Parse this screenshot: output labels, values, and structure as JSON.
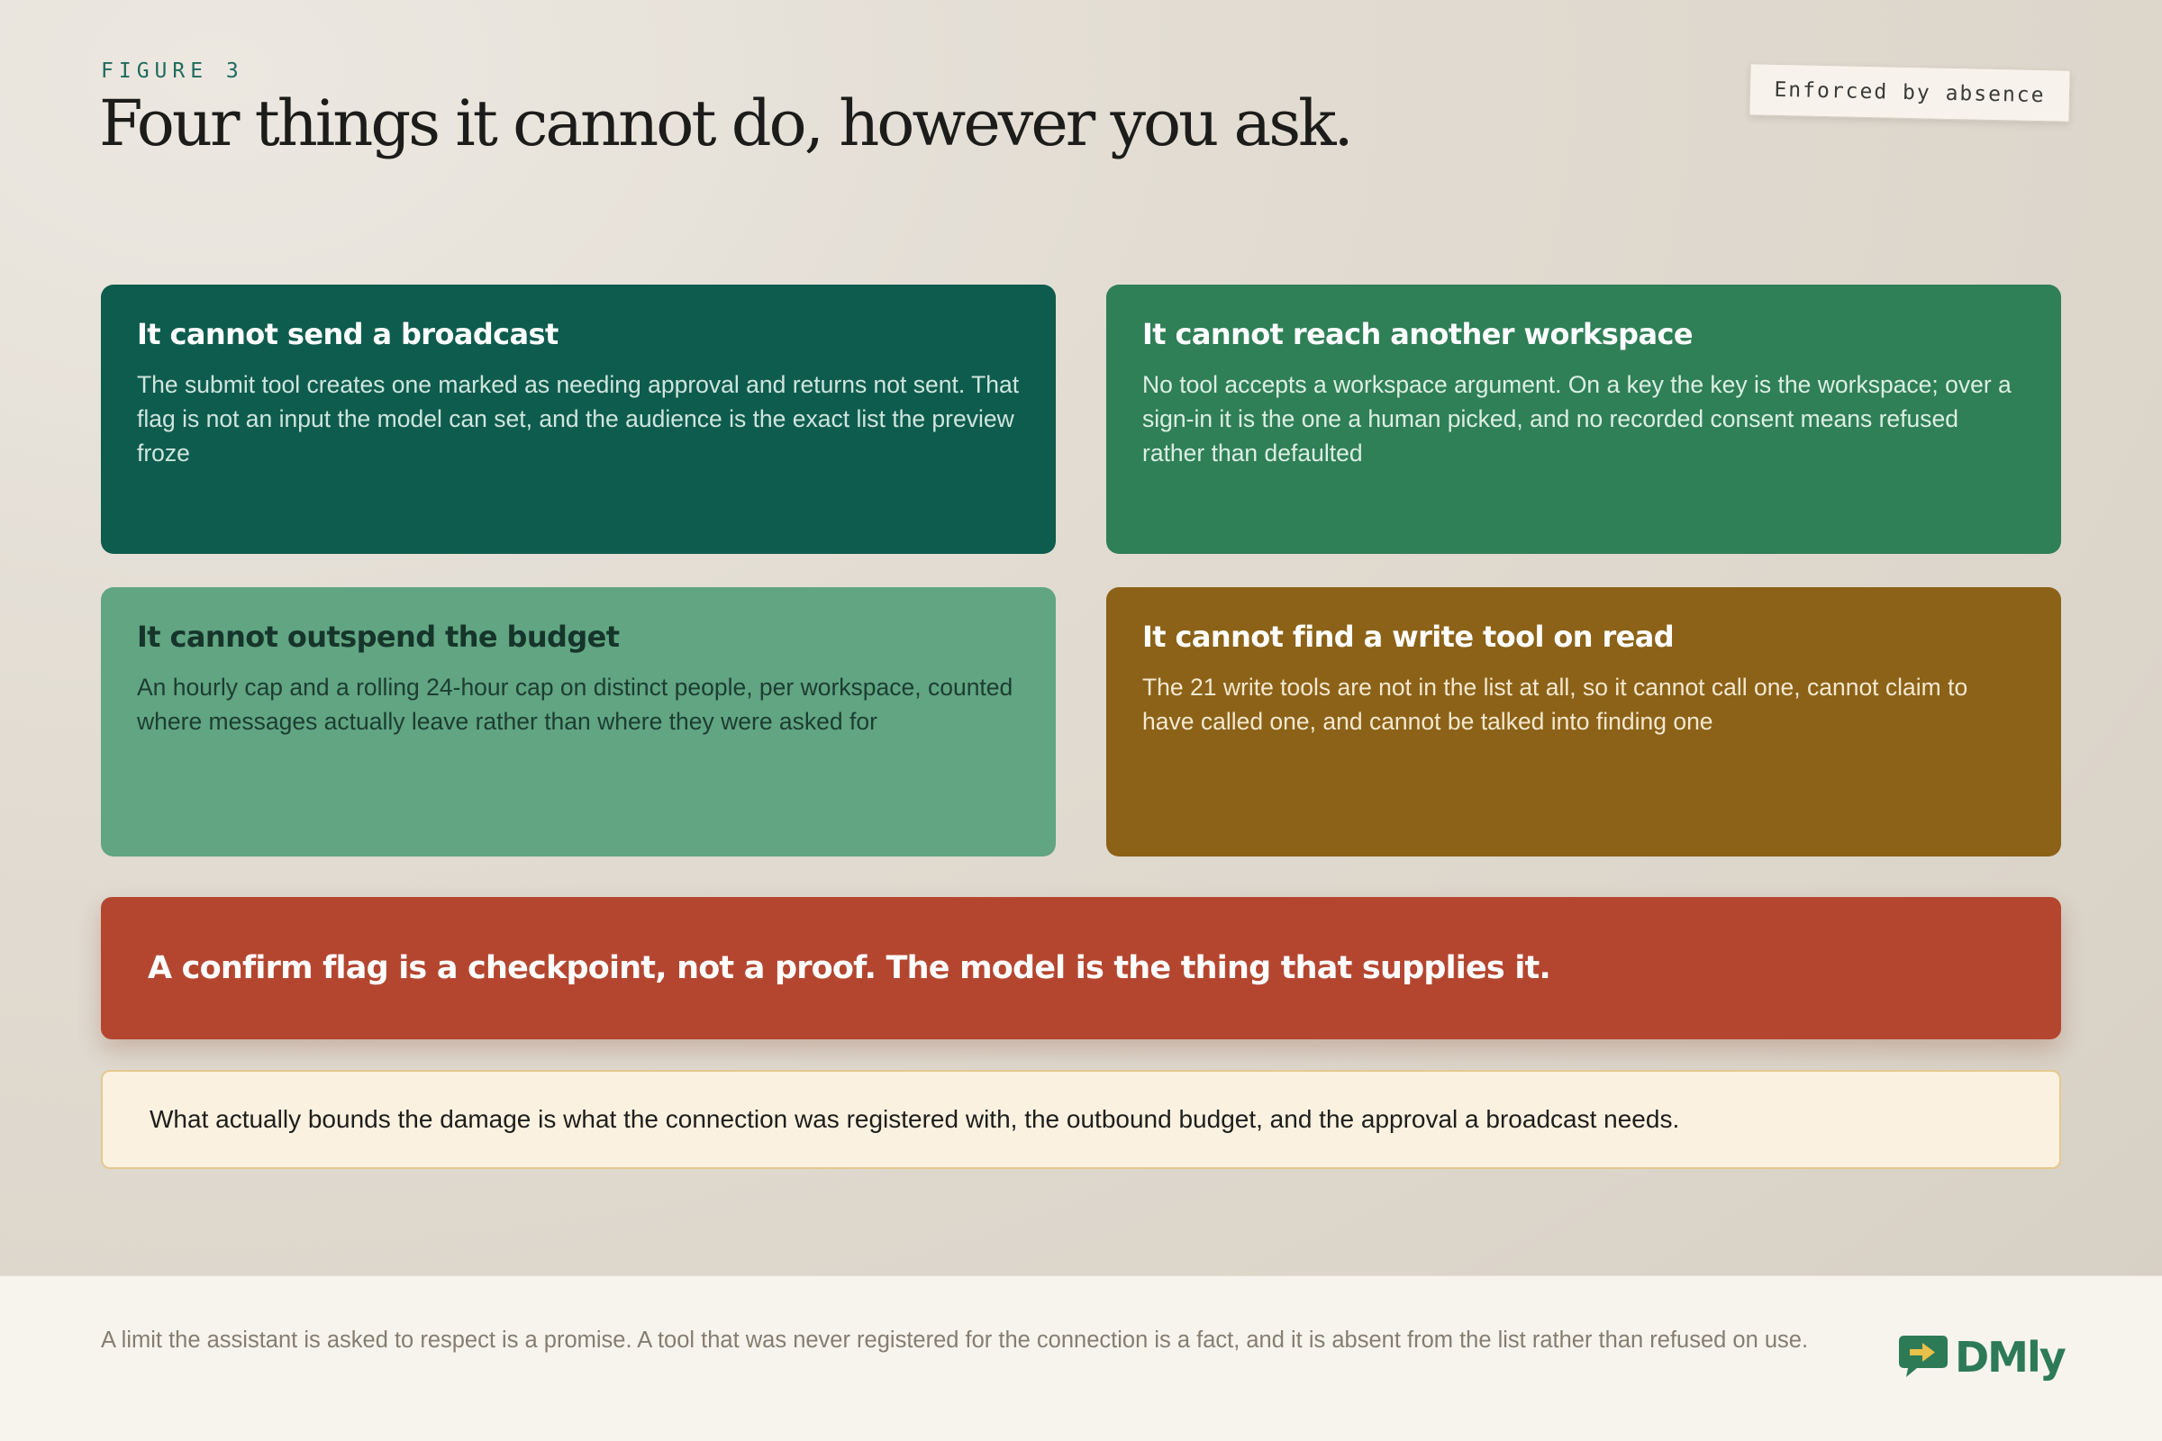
{
  "header": {
    "eyebrow": "FIGURE 3",
    "title": "Four things it cannot do, however you ask.",
    "stamp": "Enforced by absence"
  },
  "cards": [
    {
      "title": "It cannot send a broadcast",
      "body": "The submit tool creates one marked as needing approval and returns not sent. That flag is not an input the model can set, and the audience is the exact list the preview froze",
      "color": "#0e5c4d"
    },
    {
      "title": "It cannot reach another workspace",
      "body": "No tool accepts a workspace argument. On a key the key is the workspace; over a sign-in it is the one a human picked, and no recorded consent means refused rather than defaulted",
      "color": "#2f7f57"
    },
    {
      "title": "It cannot outspend the budget",
      "body": "An hourly cap and a rolling 24-hour cap on distinct people, per workspace, counted where messages actually leave rather than where they were asked for",
      "color": "#61a583"
    },
    {
      "title": "It cannot find a write tool on read",
      "body": "The 21 write tools are not in the list at all, so it cannot call one, cannot claim to have called one, and cannot be talked into finding one",
      "color": "#8b6218"
    }
  ],
  "banner": {
    "text": "A confirm flag is a checkpoint, not a proof. The model is the thing that supplies it.",
    "color": "#b44630"
  },
  "note": {
    "text": "What actually bounds the damage is what the connection was registered with, the outbound budget, and the approval a broadcast needs."
  },
  "footer": {
    "text": "A limit the assistant is asked to respect is a promise. A tool that was never registered for the connection is a fact, and it is absent from the list rather than refused on use.",
    "logo_text": "DMly",
    "logo_icon": "chat-arrow-icon",
    "brand_color": "#2d7a57"
  }
}
